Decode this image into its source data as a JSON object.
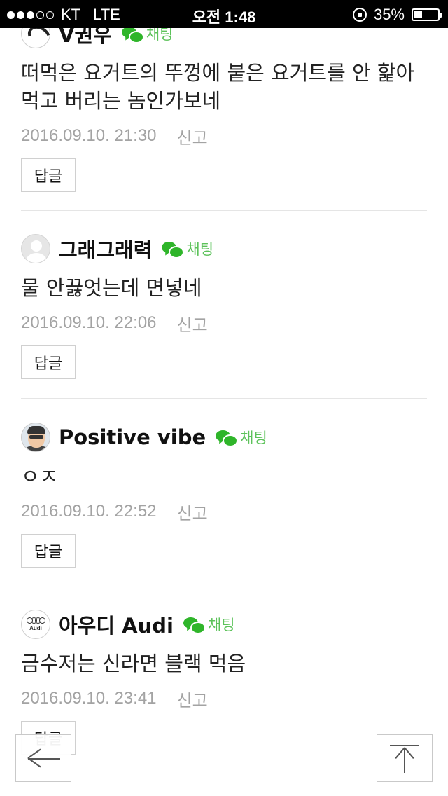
{
  "status_bar": {
    "carrier": "KT",
    "network": "LTE",
    "time": "오전 1:48",
    "battery": "35%",
    "battery_level": 0.35
  },
  "chat_label": "채팅",
  "report_label": "신고",
  "reply_label": "답글",
  "comments": [
    {
      "username": "V권우",
      "text": "떠먹은 요거트의 뚜껑에 붙은 요거트를 안 핥아 먹고 버리는 놈인가보네",
      "timestamp": "2016.09.10. 21:30"
    },
    {
      "username": "그래그래력",
      "text": "물 안끓엇는데 면넣네",
      "timestamp": "2016.09.10. 22:06"
    },
    {
      "username": "Positive vibe",
      "text": "ㅇㅈ",
      "timestamp": "2016.09.10. 22:52"
    },
    {
      "username": "아우디 Audi",
      "text": "금수저는 신라면 블랙 먹음",
      "timestamp": "2016.09.10. 23:41"
    }
  ],
  "audi_logo_text": "Audi",
  "colors": {
    "chat_green": "#2fb52a",
    "chat_text": "#5cc25a",
    "meta_gray": "#a3a3a3"
  }
}
